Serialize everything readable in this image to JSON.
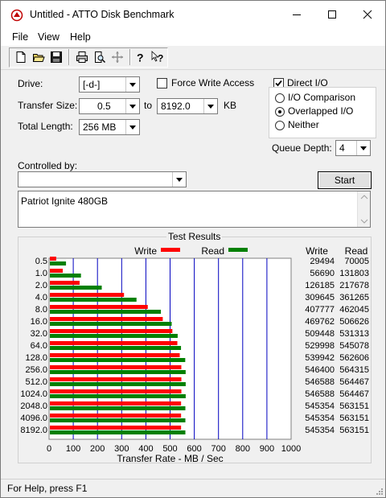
{
  "window": {
    "title": "Untitled - ATTO Disk Benchmark"
  },
  "menu": {
    "file": "File",
    "view": "View",
    "help": "Help"
  },
  "toolbar": {
    "buttons": [
      "new-document-icon",
      "open-folder-icon",
      "save-disk-icon",
      "print-icon",
      "print-preview-icon",
      "move-cross-icon",
      "help-question-icon",
      "context-help-icon"
    ]
  },
  "form": {
    "drive_label": "Drive:",
    "drive_value": "[-d-]",
    "force_write_label": "Force Write Access",
    "force_write_checked": false,
    "direct_io_label": "Direct I/O",
    "direct_io_checked": true,
    "transfer_size_label": "Transfer Size:",
    "transfer_from": "0.5",
    "to_label": "to",
    "transfer_to": "8192.0",
    "kb_label": "KB",
    "total_length_label": "Total Length:",
    "total_length_value": "256 MB",
    "io_comparison_label": "I/O Comparison",
    "overlapped_io_label": "Overlapped I/O",
    "neither_label": "Neither",
    "io_mode_selected": "Overlapped I/O",
    "queue_depth_label": "Queue Depth:",
    "queue_depth_value": "4",
    "controlled_by_label": "Controlled by:",
    "controlled_by_value": "",
    "start_label": "Start",
    "description": "Patriot Ignite 480GB"
  },
  "results": {
    "title": "Test Results",
    "write_legend": "Write",
    "read_legend": "Read",
    "write_col": "Write",
    "read_col": "Read"
  },
  "colors": {
    "write": "#ff0000",
    "read": "#008000",
    "grid": "#0000c0"
  },
  "chart_data": {
    "type": "bar",
    "orientation": "horizontal",
    "categories": [
      "0.5",
      "1.0",
      "2.0",
      "4.0",
      "8.0",
      "16.0",
      "32.0",
      "64.0",
      "128.0",
      "256.0",
      "512.0",
      "1024.0",
      "2048.0",
      "4096.0",
      "8192.0"
    ],
    "series": [
      {
        "name": "Write",
        "values": [
          29494,
          56690,
          126185,
          309645,
          407777,
          469762,
          509448,
          529998,
          539942,
          546400,
          546588,
          546588,
          545354,
          545354,
          545354
        ]
      },
      {
        "name": "Read",
        "values": [
          70005,
          131803,
          217678,
          361265,
          462045,
          506626,
          531313,
          545078,
          562606,
          564315,
          564467,
          564467,
          563151,
          563151,
          563151
        ]
      }
    ],
    "xlabel": "Transfer Rate - MB / Sec",
    "xticks": [
      "0",
      "100",
      "200",
      "300",
      "400",
      "500",
      "600",
      "700",
      "800",
      "900",
      "1000"
    ],
    "xlim": [
      0,
      1000
    ],
    "legend": "top"
  },
  "status": {
    "text": "For Help, press F1"
  }
}
